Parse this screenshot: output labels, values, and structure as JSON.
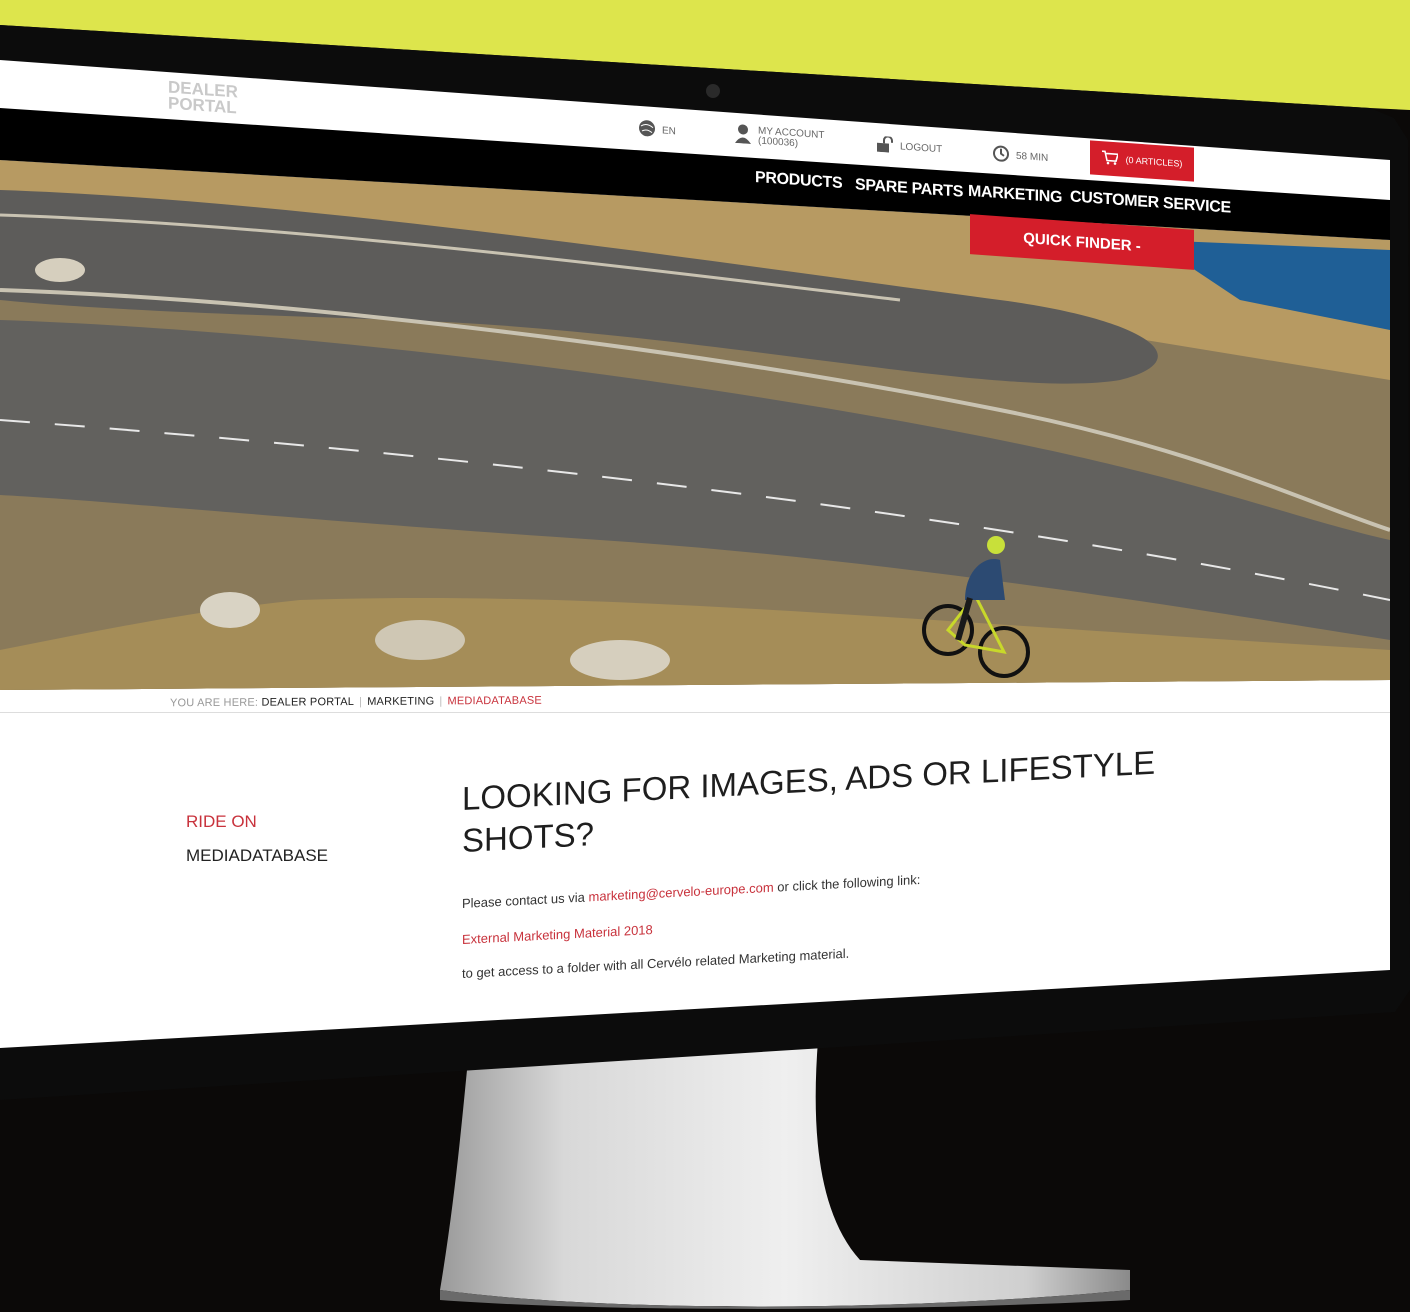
{
  "header": {
    "logo_line1": "DEALER",
    "logo_line2": "PORTAL",
    "language": "EN",
    "account_label": "MY ACCOUNT",
    "account_number": "(100036)",
    "logout_label": "LOGOUT",
    "session_time": "58 MIN",
    "cart_label": "(0 ARTICLES)"
  },
  "nav": {
    "items": [
      "PRODUCTS",
      "SPARE PARTS",
      "MARKETING",
      "CUSTOMER SERVICE"
    ],
    "quick_finder": "QUICK FINDER -"
  },
  "breadcrumb": {
    "prefix": "YOU ARE HERE:",
    "items": [
      "DEALER PORTAL",
      "MARKETING",
      "MEDIADATABASE"
    ]
  },
  "sidebar": {
    "items": [
      "RIDE ON",
      "MEDIADATABASE"
    ]
  },
  "main": {
    "headline_line1": "LOOKING FOR IMAGES, ADS OR LIFESTYLE",
    "headline_line2": "SHOTS?",
    "contact_prefix": "Please contact us via",
    "contact_email": "marketing@cervelo-europe.com",
    "contact_suffix": "or click the following link:",
    "external_link": "External Marketing Material 2018",
    "footer_text": "to get access to a folder with all Cervélo related Marketing material."
  },
  "colors": {
    "backdrop": "#dde54c",
    "accent_red": "#d41e2a",
    "link_red": "#c8323c"
  },
  "icons": [
    "globe-icon",
    "user-icon",
    "lock-icon",
    "clock-icon",
    "cart-icon"
  ]
}
